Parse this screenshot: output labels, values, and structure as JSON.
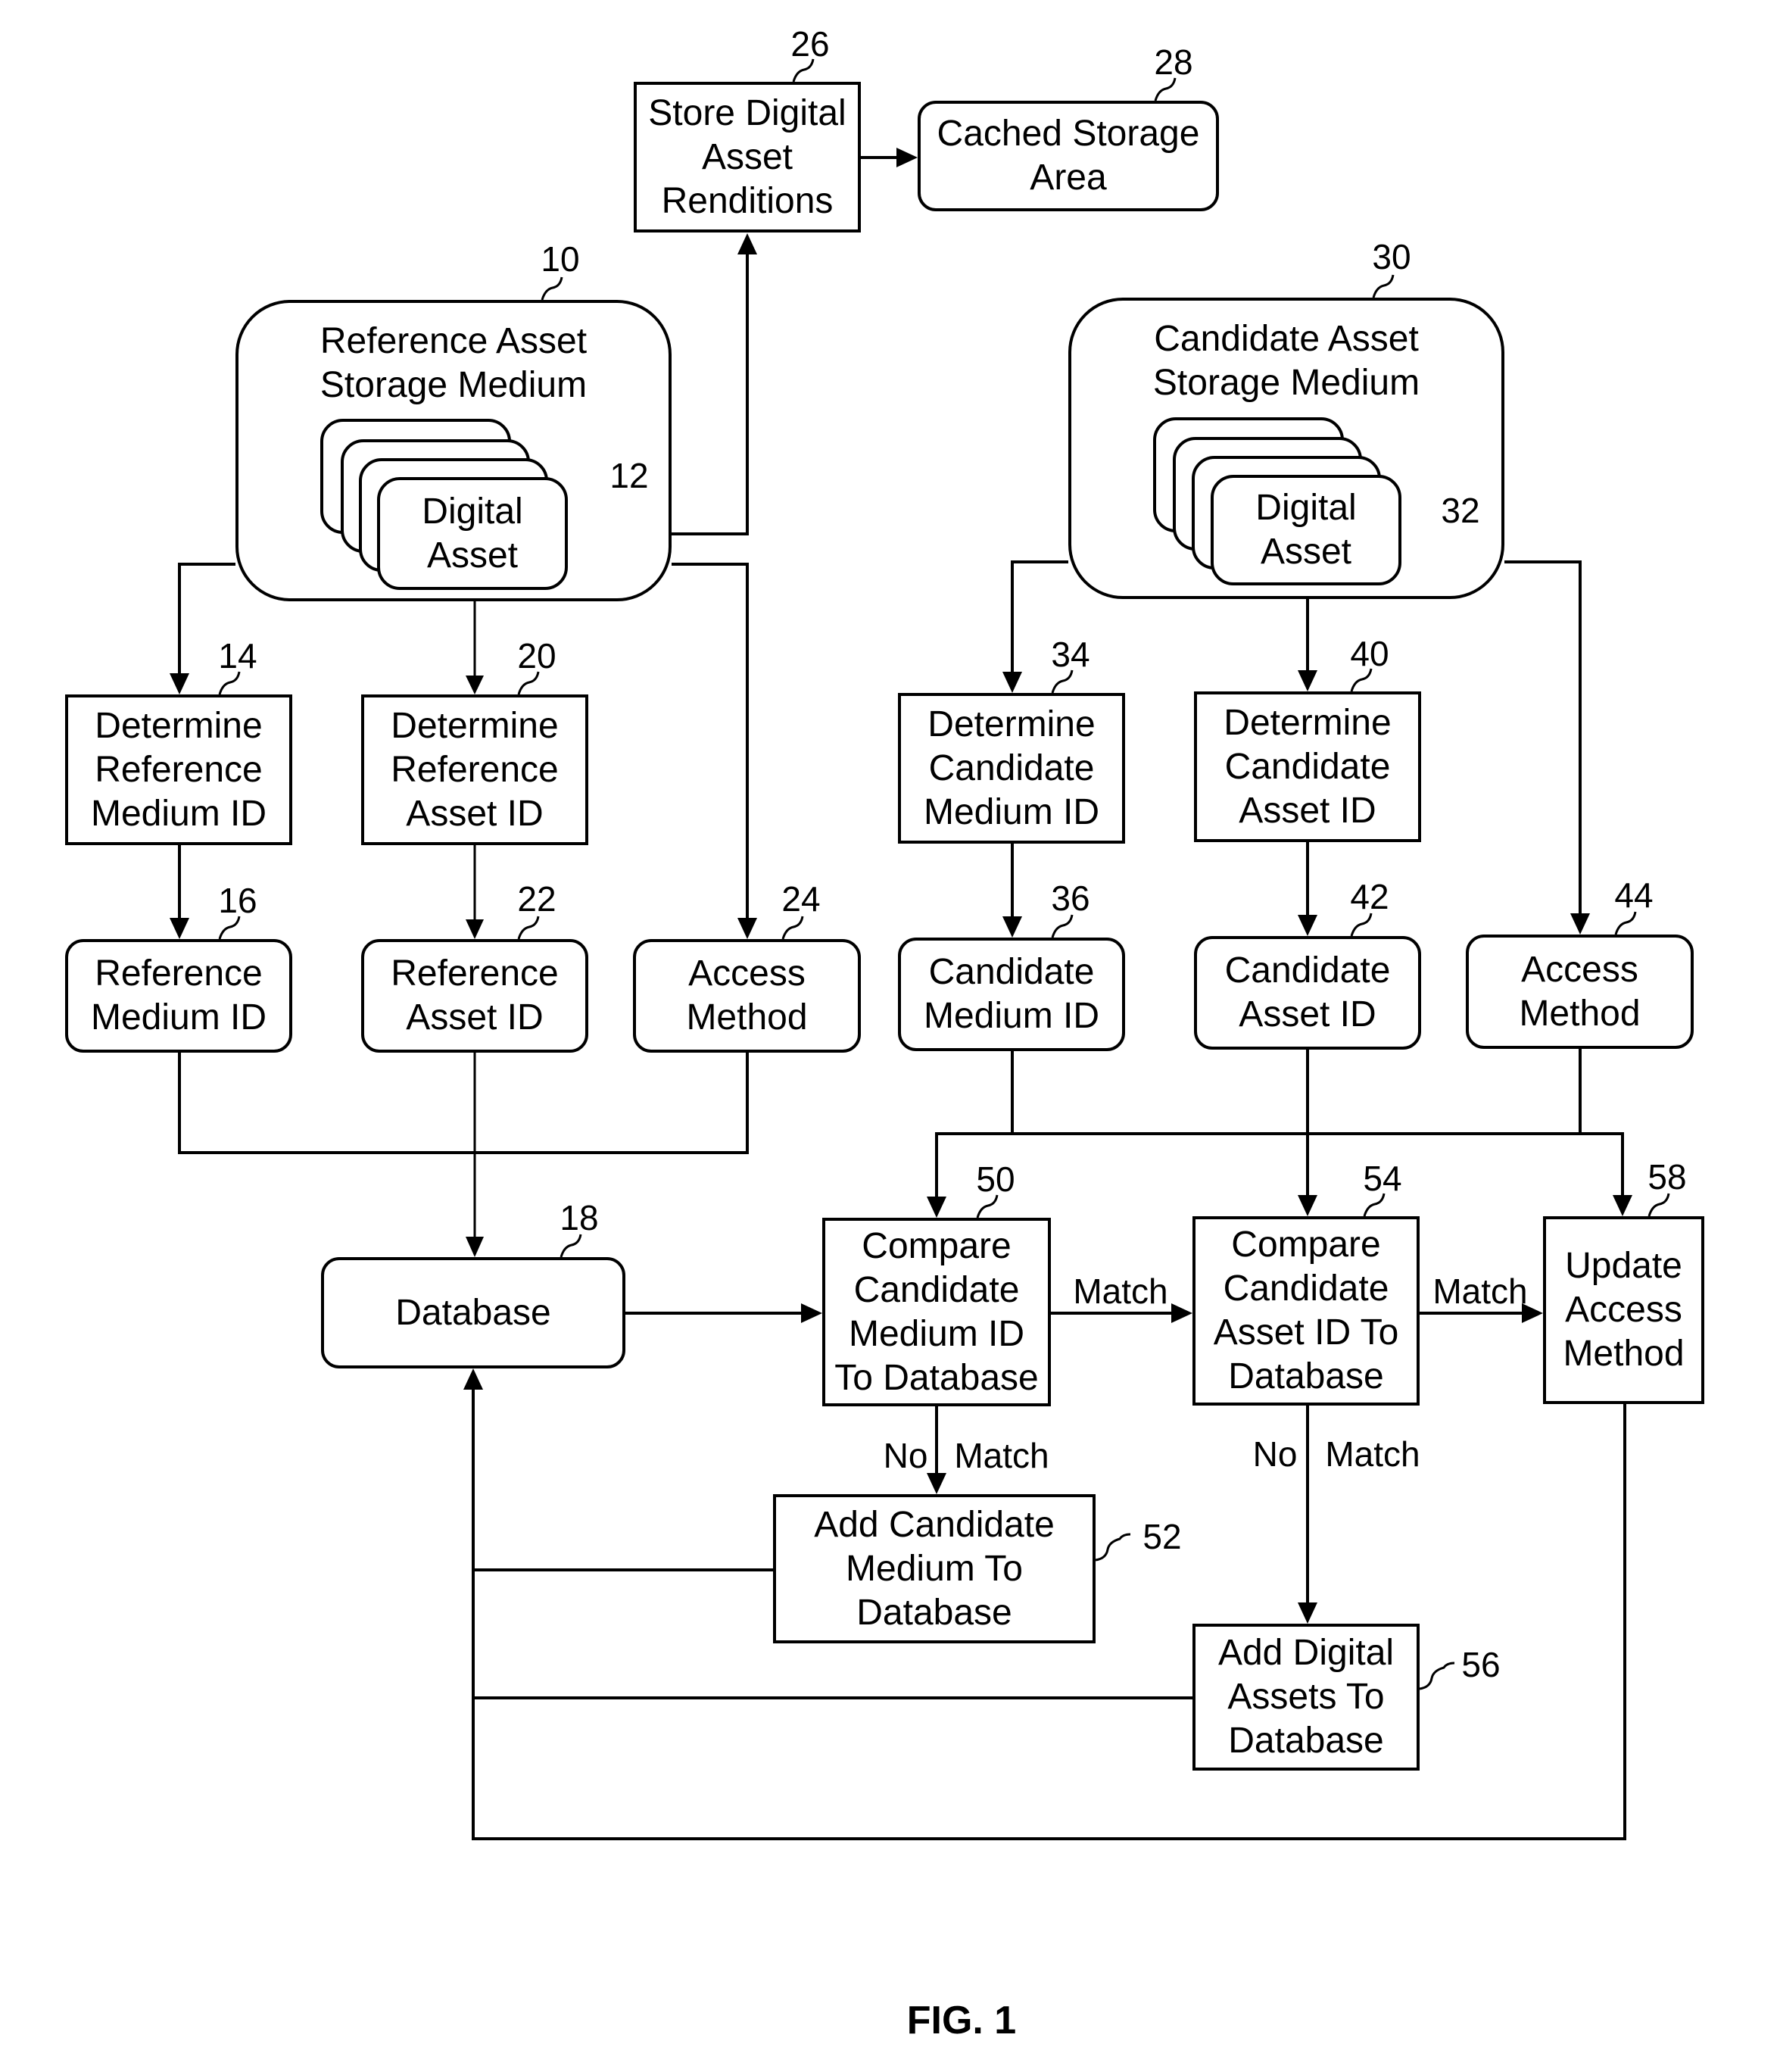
{
  "figure_label": "FIG. 1",
  "nodes": {
    "n26": {
      "ref": "26",
      "label": "Store Digital\nAsset\nRenditions"
    },
    "n28": {
      "ref": "28",
      "label": "Cached Storage\nArea"
    },
    "n10": {
      "ref": "10",
      "label": "Reference Asset\nStorage Medium"
    },
    "n12": {
      "ref": "12",
      "label": "Digital\nAsset"
    },
    "n30": {
      "ref": "30",
      "label": "Candidate Asset\nStorage Medium"
    },
    "n32": {
      "ref": "32",
      "label": "Digital\nAsset"
    },
    "n14": {
      "ref": "14",
      "label": "Determine\nReference\nMedium ID"
    },
    "n20": {
      "ref": "20",
      "label": "Determine\nReference\nAsset ID"
    },
    "n16": {
      "ref": "16",
      "label": "Reference\nMedium ID"
    },
    "n22": {
      "ref": "22",
      "label": "Reference\nAsset ID"
    },
    "n24": {
      "ref": "24",
      "label": "Access\nMethod"
    },
    "n34": {
      "ref": "34",
      "label": "Determine\nCandidate\nMedium ID"
    },
    "n40": {
      "ref": "40",
      "label": "Determine\nCandidate\nAsset ID"
    },
    "n36": {
      "ref": "36",
      "label": "Candidate\nMedium ID"
    },
    "n42": {
      "ref": "42",
      "label": "Candidate\nAsset ID"
    },
    "n44": {
      "ref": "44",
      "label": "Access\nMethod"
    },
    "n18": {
      "ref": "18",
      "label": "Database"
    },
    "n50": {
      "ref": "50",
      "label": "Compare\nCandidate\nMedium ID\nTo Database"
    },
    "n54": {
      "ref": "54",
      "label": "Compare\nCandidate\nAsset ID To\nDatabase"
    },
    "n58": {
      "ref": "58",
      "label": "Update\nAccess\nMethod"
    },
    "n52": {
      "ref": "52",
      "label": "Add Candidate\nMedium To\nDatabase"
    },
    "n56": {
      "ref": "56",
      "label": "Add Digital\nAssets To\nDatabase"
    }
  },
  "edge_labels": {
    "match_50_54": "Match",
    "match_54_58": "Match",
    "no_50": "No",
    "match_50_down": "Match",
    "no_54": "No",
    "match_54_down": "Match"
  }
}
